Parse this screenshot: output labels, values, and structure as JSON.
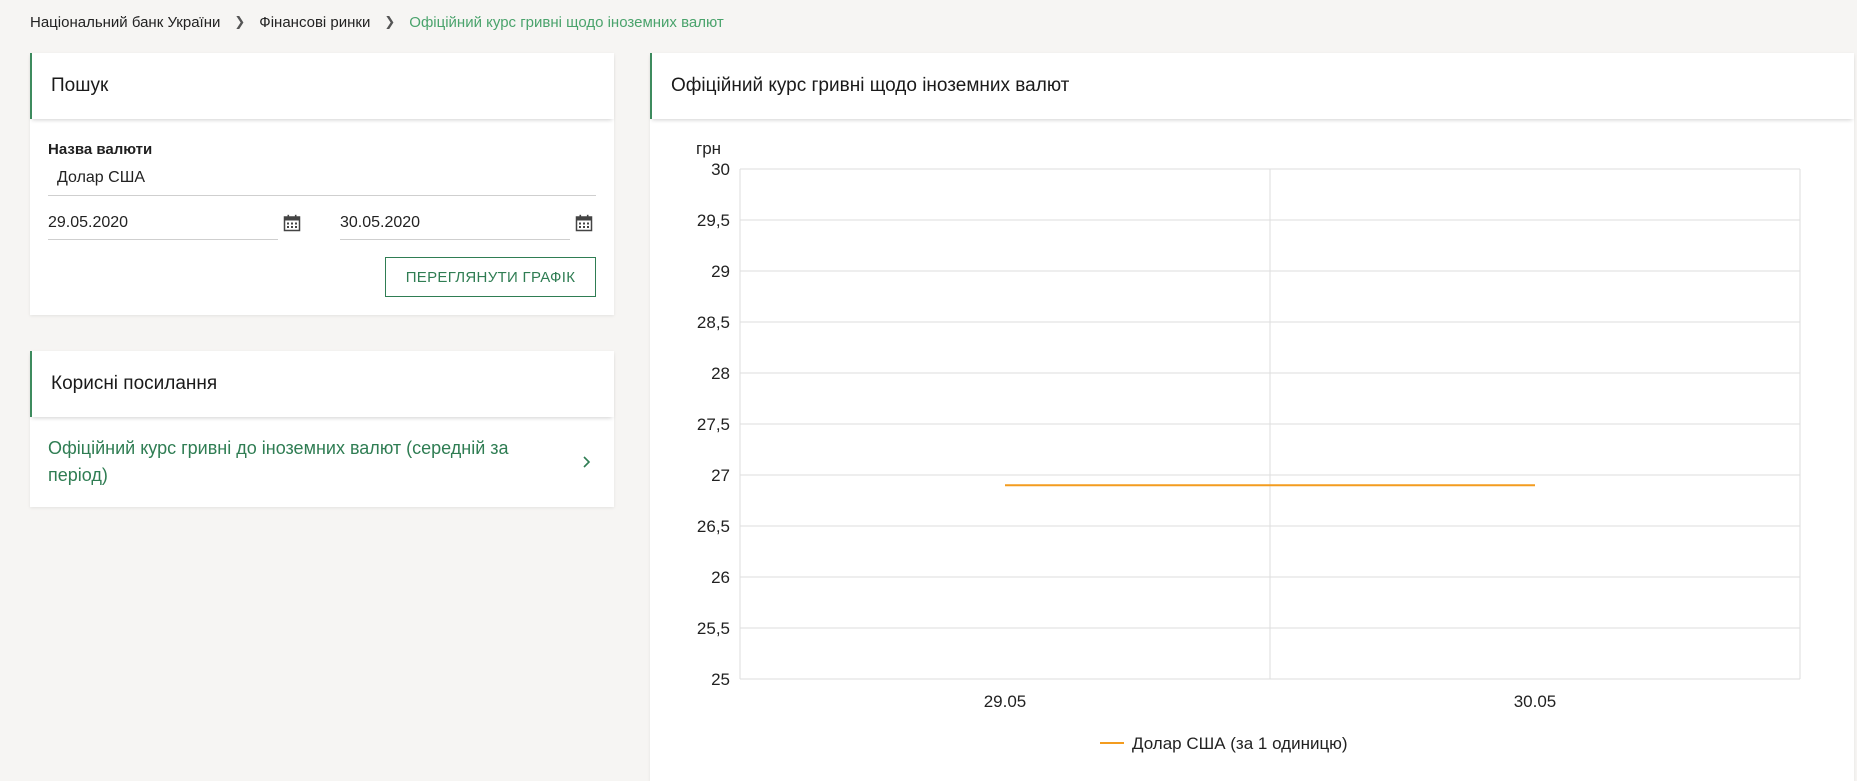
{
  "breadcrumb": {
    "items": [
      "Національний банк України",
      "Фінансові ринки"
    ],
    "current": "Офіційний курс гривні щодо іноземних валют"
  },
  "search": {
    "title": "Пошук",
    "currency_label": "Назва валюти",
    "currency_value": "Долар США",
    "date_from": "29.05.2020",
    "date_to": "30.05.2020",
    "button_label": "ПЕРЕГЛЯНУТИ ГРАФІК"
  },
  "links": {
    "title": "Корисні посилання",
    "items": [
      {
        "label": "Офіційний курс гривні до іноземних валют (середній за період)"
      }
    ]
  },
  "chart_panel": {
    "title": "Офіційний курс гривні щодо іноземних валют"
  },
  "colors": {
    "accent": "#2f7d53",
    "breadcrumb_current": "#4aa36c",
    "series": "#f39c1f"
  },
  "chart_data": {
    "type": "line",
    "categories": [
      "29.05",
      "30.05"
    ],
    "series": [
      {
        "name": "Долар США (за 1 одиницю)",
        "values": [
          26.9,
          26.9
        ],
        "color": "#f39c1f"
      }
    ],
    "ylabel": "грн",
    "ylim": [
      25,
      30
    ],
    "yticks": [
      "25",
      "25,5",
      "26",
      "26,5",
      "27",
      "27,5",
      "28",
      "28,5",
      "29",
      "29,5",
      "30"
    ],
    "grid": true,
    "legend": "bottom-center"
  }
}
